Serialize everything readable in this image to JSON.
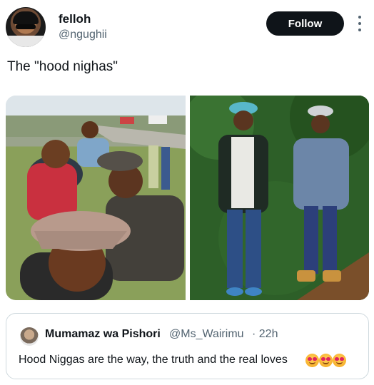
{
  "tweet": {
    "author_name": "felloh",
    "author_handle": "@ngughii",
    "follow_label": "Follow",
    "text": "The \"hood nighas\""
  },
  "media": {
    "photos": [
      "group-of-men-roadside-photo",
      "two-men-posing-by-hedge-photo"
    ]
  },
  "quoted": {
    "name": "Mumamaz wa Pishori",
    "handle": "@Ms_Wairimu",
    "time": "· 22h",
    "text": "Hood Niggas are the way, the truth and the real loves",
    "emojis": [
      "heart-eyes-emoji",
      "heart-eyes-emoji",
      "heart-eyes-emoji"
    ]
  },
  "icons": [
    "more-options-icon"
  ],
  "colors": {
    "follow_bg": "#0f1419",
    "secondary_text": "#536471",
    "border": "#cfd9de"
  }
}
